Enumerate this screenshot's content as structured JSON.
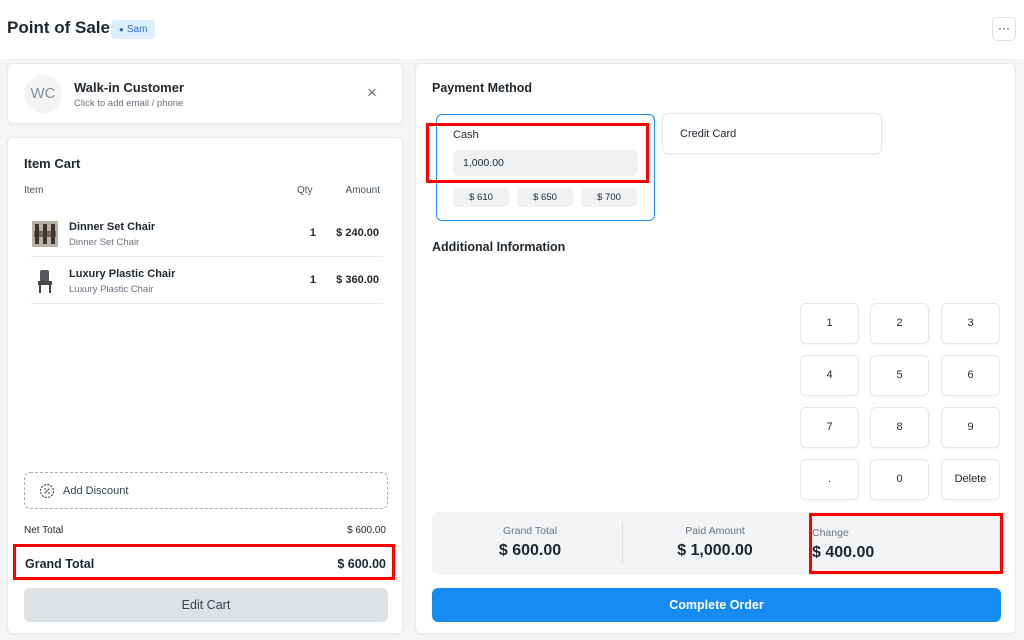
{
  "header": {
    "title": "Point of Sale",
    "badge": "Sam",
    "menu_label": "···"
  },
  "customer": {
    "initials": "WC",
    "name": "Walk-in Customer",
    "subtitle": "Click to add email / phone",
    "close_icon": "×"
  },
  "cart": {
    "title": "Item Cart",
    "columns": {
      "item": "Item",
      "qty": "Qty",
      "amount": "Amount"
    },
    "items": [
      {
        "name": "Dinner Set Chair",
        "subtitle": "Dinner Set Chair",
        "qty": "1",
        "amount": "$ 240.00"
      },
      {
        "name": "Luxury Plastic Chair",
        "subtitle": "Luxury Plastic Chair",
        "qty": "1",
        "amount": "$ 360.00"
      }
    ],
    "add_discount": "Add Discount",
    "net_total_label": "Net Total",
    "net_total_value": "$ 600.00",
    "grand_total_label": "Grand Total",
    "grand_total_value": "$ 600.00",
    "edit_cart": "Edit Cart"
  },
  "payment": {
    "title": "Payment Method",
    "cash": {
      "label": "Cash",
      "value": "1,000.00",
      "quick_amounts": [
        "$ 610",
        "$ 650",
        "$ 700"
      ]
    },
    "credit_card_label": "Credit Card",
    "additional_info": "Additional Information",
    "numpad": [
      "1",
      "2",
      "3",
      "4",
      "5",
      "6",
      "7",
      "8",
      "9",
      ".",
      "0",
      "Delete"
    ],
    "summary": {
      "grand_total_label": "Grand Total",
      "grand_total_value": "$ 600.00",
      "paid_amount_label": "Paid Amount",
      "paid_amount_value": "$ 1,000.00",
      "change_label": "Change",
      "change_value": "$ 400.00"
    },
    "complete_order": "Complete Order"
  },
  "colors": {
    "accent": "#168cf2",
    "highlight": "#ff0000",
    "badge_bg": "#ddeeff"
  }
}
